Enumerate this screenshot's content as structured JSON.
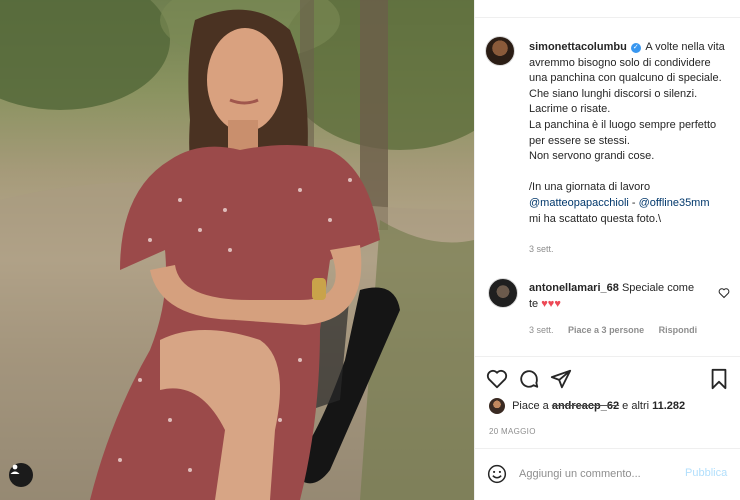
{
  "post": {
    "username": "simonettacolumbu",
    "verified_icon": "verified-badge-icon",
    "caption_lines": [
      "A volte nella vita",
      "avremmo bisogno solo di condividere",
      "una panchina con qualcuno di speciale.",
      "Che siano lunghi discorsi o silenzi.",
      "Lacrime o risate.",
      "La panchina è il luogo sempre perfetto",
      "per essere se stessi.",
      "Non servono grandi cose.",
      "",
      "/In una giornata di lavoro"
    ],
    "mention_1": "@matteopapacchioli",
    "mention_sep": " - ",
    "mention_2": "@offline35mm",
    "caption_last": "mi ha scattato questa foto.\\",
    "caption_time": "3 sett."
  },
  "comment": {
    "username": "antonellamari_68",
    "text": "Speciale come",
    "text_2": "te",
    "hearts": "♥♥♥",
    "time": "3 sett.",
    "likes": "Piace a 3 persone",
    "reply": "Rispondi"
  },
  "likes": {
    "prefix": "Piace a",
    "user": "andreacp_62",
    "suffix": "e altri",
    "count": "11.282"
  },
  "date": "20 MAGGIO",
  "add_comment": {
    "placeholder": "Aggiungi un commento...",
    "publish": "Pubblica"
  },
  "colors": {
    "accent_blue": "#3897f0",
    "publish_disabled": "#b2dffc",
    "heart_red": "#ed4956"
  },
  "icons": [
    "heart-icon",
    "comment-icon",
    "share-icon",
    "bookmark-icon",
    "smile-icon",
    "user-tag-icon"
  ]
}
